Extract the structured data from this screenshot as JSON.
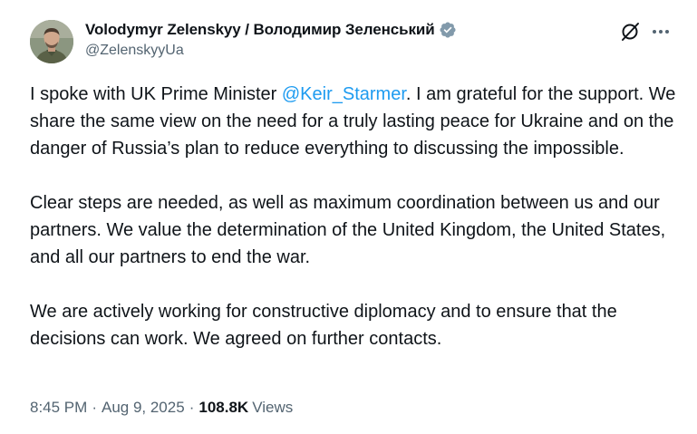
{
  "author": {
    "display_name": "Volodymyr Zelenskyy / Володимир Зеленський",
    "handle": "@ZelenskyyUa",
    "verified_icon": "verified-badge-icon",
    "verified_color": "#829aab"
  },
  "actions": {
    "grok_icon": "grok-icon",
    "more_icon": "more-options-icon"
  },
  "tweet": {
    "para1_before": "I spoke with UK Prime Minister ",
    "para1_mention": "@Keir_Starmer",
    "para1_after": ". I am grateful for the support. We share the same view on the need for a truly lasting peace for Ukraine and on the danger of Russia’s plan to reduce everything to discussing the impossible.",
    "para2": "Clear steps are needed, as well as maximum coordination between us and our partners. We value the determination of the United Kingdom, the United States, and all our partners to end the war.",
    "para3": "We are actively working for constructive diplomacy and to ensure that the decisions can work. We agreed on further contacts."
  },
  "meta": {
    "time": "8:45 PM",
    "separator": "·",
    "date": "Aug 9, 2025",
    "views_count": "108.8K",
    "views_label": "Views"
  },
  "colors": {
    "text_primary": "#0f1419",
    "text_secondary": "#536471",
    "link": "#1d9bf0"
  }
}
